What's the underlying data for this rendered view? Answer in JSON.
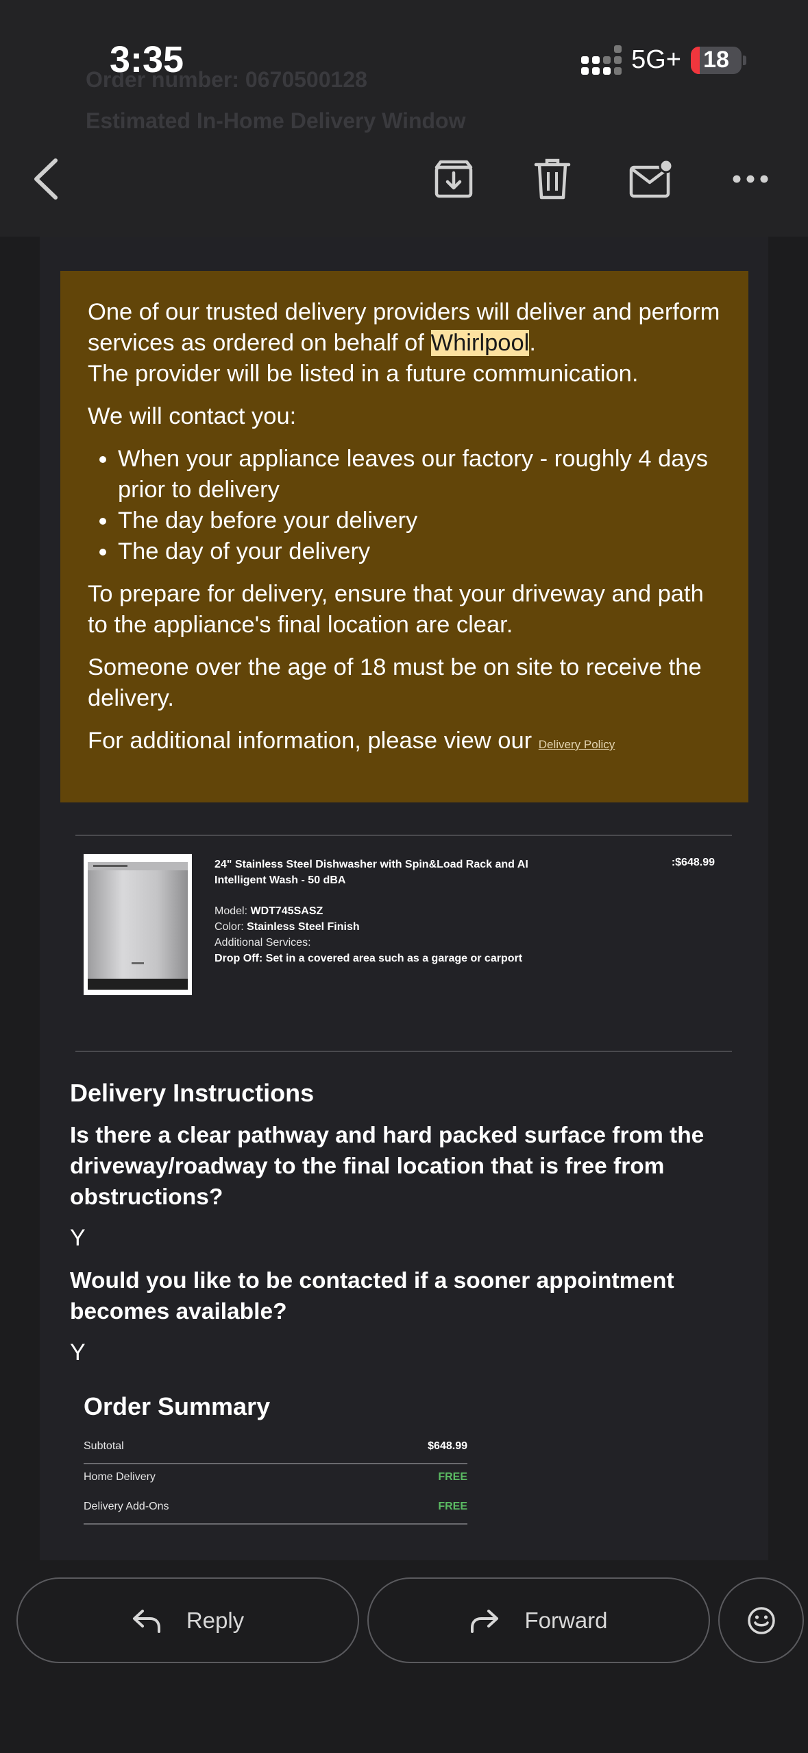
{
  "status_bar": {
    "time": "3:35",
    "network": "5G+",
    "battery": "18",
    "battery_level_percent": 18
  },
  "background_text": {
    "line1": "Order number: 0670500128",
    "line2": "Estimated In-Home Delivery Window"
  },
  "toolbar": {
    "back_icon": "chevron-left-icon",
    "archive_icon": "archive-icon",
    "trash_icon": "trash-icon",
    "mark_unread_icon": "mail-unread-icon",
    "more_icon": "more-icon"
  },
  "notice": {
    "line_before": "One of our trusted delivery providers will deliver and perform services as ordered on behalf of ",
    "brand": "Whirlpool",
    "line_after": ".",
    "provider_line": "The provider will be listed in a future communication.",
    "contact_intro": "We will contact you:",
    "contact_items": [
      "When your appliance leaves our factory - roughly 4 days prior to delivery",
      "The day before your delivery",
      "The day of your delivery"
    ],
    "prepare": "To prepare for delivery, ensure that your driveway and path to the appliance's final location are clear.",
    "age": "Someone over the age of 18 must be on site to receive the delivery.",
    "info_prefix": "For additional information, please view our ",
    "policy_link": "Delivery Policy"
  },
  "product": {
    "title": "24\" Stainless Steel Dishwasher with Spin&Load Rack and AI Intelligent Wash - 50 dBA",
    "model_label": "Model: ",
    "model": "WDT745SASZ",
    "color_label": "Color: ",
    "color": "Stainless Steel Finish",
    "services_label": "Additional Services:",
    "service": "Drop Off: Set in a covered area such as a garage or carport",
    "price": ":$648.99"
  },
  "instructions": {
    "heading": "Delivery Instructions",
    "items": [
      {
        "question": "Is there a clear pathway and hard packed surface from the driveway/roadway to the final location that is free from obstructions?",
        "answer": "Y"
      },
      {
        "question": "Would you like to be contacted if a sooner appointment becomes available?",
        "answer": "Y"
      }
    ]
  },
  "summary": {
    "heading": "Order Summary",
    "rows": [
      {
        "label": "Subtotal",
        "value": "$648.99"
      },
      {
        "label": "Home Delivery",
        "value": "FREE"
      },
      {
        "label": "Delivery Add-Ons",
        "value": "FREE"
      }
    ]
  },
  "actions": {
    "reply": "Reply",
    "forward": "Forward",
    "reaction_icon": "smiley-icon"
  },
  "colors": {
    "notice_bg": "#624509",
    "free_green": "#5bbb63",
    "highlight": "#fde2a0"
  }
}
